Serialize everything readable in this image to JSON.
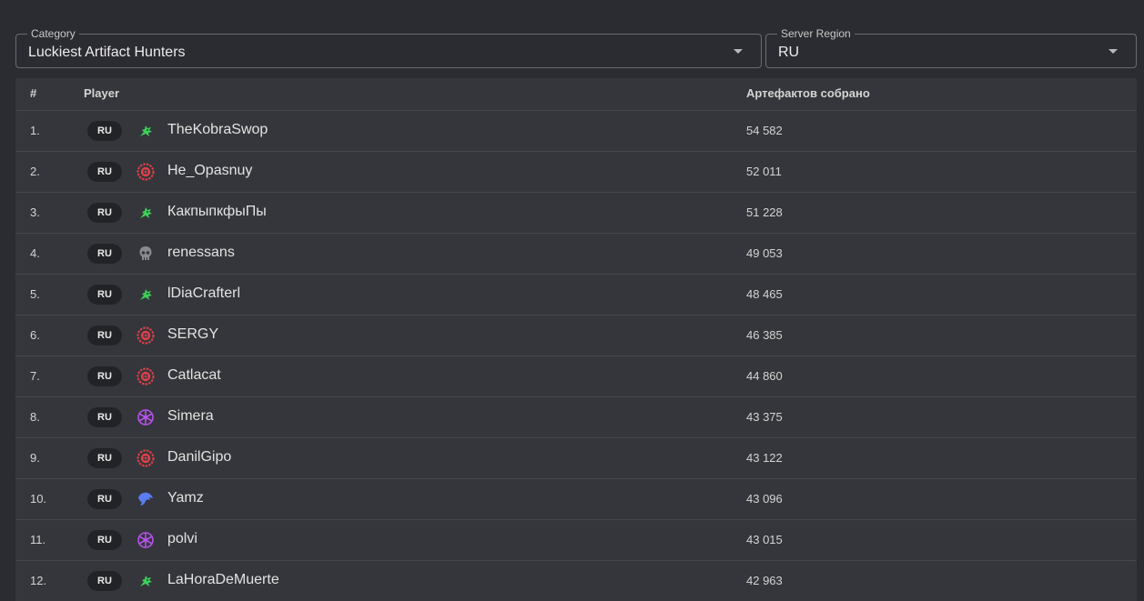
{
  "filters": {
    "category": {
      "label": "Category",
      "value": "Luckiest Artifact Hunters"
    },
    "region": {
      "label": "Server Region",
      "value": "RU"
    }
  },
  "table": {
    "headers": {
      "rank": "#",
      "player": "Player",
      "value": "Артефактов собрано"
    },
    "rows": [
      {
        "rank": "1.",
        "region": "RU",
        "icon": "green-dragon-icon",
        "name": "TheKobraSwop",
        "value": "54 582"
      },
      {
        "rank": "2.",
        "region": "RU",
        "icon": "red-shield-icon",
        "name": "He_Opasnuy",
        "value": "52 011"
      },
      {
        "rank": "3.",
        "region": "RU",
        "icon": "green-dragon-icon",
        "name": "КакпыпкфыПы",
        "value": "51 228"
      },
      {
        "rank": "4.",
        "region": "RU",
        "icon": "skull-icon",
        "name": "renessans",
        "value": "49 053"
      },
      {
        "rank": "5.",
        "region": "RU",
        "icon": "green-dragon-icon",
        "name": "lDiaCrafterl",
        "value": "48 465"
      },
      {
        "rank": "6.",
        "region": "RU",
        "icon": "red-shield-icon",
        "name": "SERGY",
        "value": "46 385"
      },
      {
        "rank": "7.",
        "region": "RU",
        "icon": "red-shield-icon",
        "name": "Catlacat",
        "value": "44 860"
      },
      {
        "rank": "8.",
        "region": "RU",
        "icon": "purple-star-icon",
        "name": "Simera",
        "value": "43 375"
      },
      {
        "rank": "9.",
        "region": "RU",
        "icon": "red-shield-icon",
        "name": "DanilGipo",
        "value": "43 122"
      },
      {
        "rank": "10.",
        "region": "RU",
        "icon": "blue-eagle-icon",
        "name": "Yamz",
        "value": "43 096"
      },
      {
        "rank": "11.",
        "region": "RU",
        "icon": "purple-star-icon",
        "name": "polvi",
        "value": "43 015"
      },
      {
        "rank": "12.",
        "region": "RU",
        "icon": "green-dragon-icon",
        "name": "LaHoraDeMuerte",
        "value": "42 963"
      }
    ]
  },
  "colors": {
    "background": "#2b2c31",
    "table": "#35363b",
    "green": "#3ecf5a",
    "red": "#e0414a",
    "purple": "#b452e8",
    "blue": "#5b7cf0",
    "gray": "#8a8a8e"
  }
}
